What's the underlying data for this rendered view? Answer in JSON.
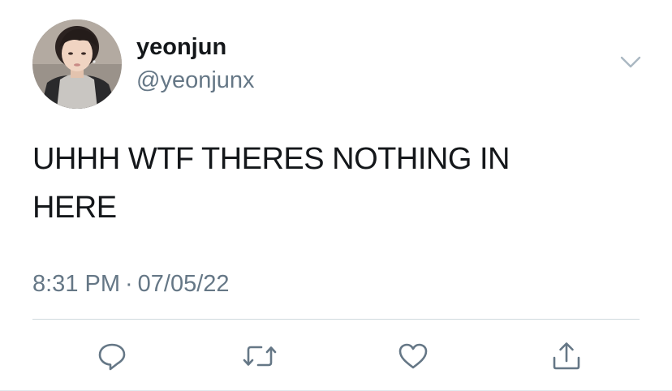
{
  "user": {
    "display_name": "yeonjun",
    "handle": "@yeonjunx"
  },
  "tweet": {
    "text_line_1": "UHHH WTF THERES NOTHING IN",
    "text_line_2": "HERE",
    "time": "8:31 PM",
    "separator": "·",
    "date": "07/05/22"
  },
  "icons": {
    "menu": "chevron-down-icon",
    "reply": "reply-icon",
    "retweet": "retweet-icon",
    "like": "heart-icon",
    "share": "share-icon"
  },
  "colors": {
    "text_primary": "#14171a",
    "text_secondary": "#657786",
    "icon": "#657786",
    "divider": "#cfd9de"
  }
}
